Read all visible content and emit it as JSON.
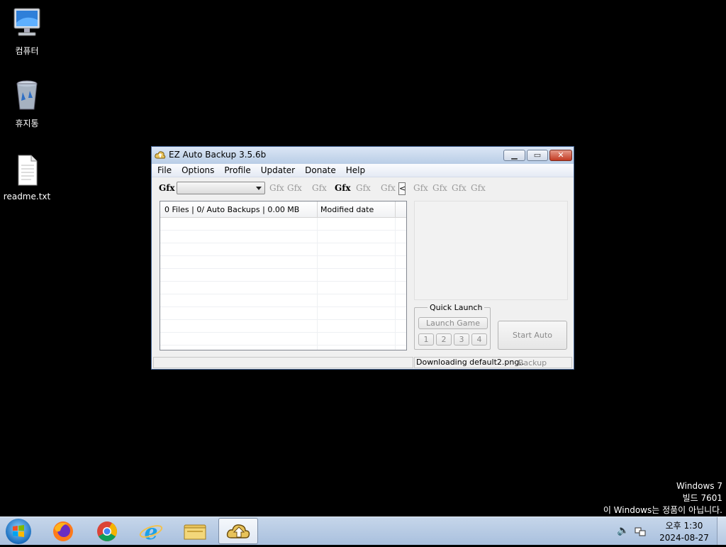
{
  "desktop": {
    "icons": [
      {
        "label": "컴퓨터"
      },
      {
        "label": "휴지통"
      },
      {
        "label": "readme.txt"
      }
    ]
  },
  "window": {
    "title": "EZ Auto Backup 3.5.6b",
    "menu": [
      "File",
      "Options",
      "Profile",
      "Updater",
      "Donate",
      "Help"
    ],
    "toolbar": {
      "gfx_label": "Gfx",
      "collapse_label": "<"
    },
    "list": {
      "col1": "0 Files | 0/ Auto Backups | 0.00 MB",
      "col2": "Modified date"
    },
    "quick_launch": {
      "legend": "Quick Launch",
      "launch_label": "Launch Game",
      "slots": [
        "1",
        "2",
        "3",
        "4"
      ]
    },
    "start_label": "Start Auto Backup",
    "status": {
      "left": "",
      "right": "Downloading default2.png.."
    }
  },
  "watermark": {
    "line1": "Windows 7",
    "line2": "빌드 7601",
    "line3": "이 Windows는 정품이 아닙니다."
  },
  "taskbar": {
    "time": "오후 1:30",
    "date": "2024-08-27"
  },
  "colors": {
    "desktop": "#000000",
    "window_frame": "#4b6b9a",
    "close_button": "#c23a22"
  }
}
